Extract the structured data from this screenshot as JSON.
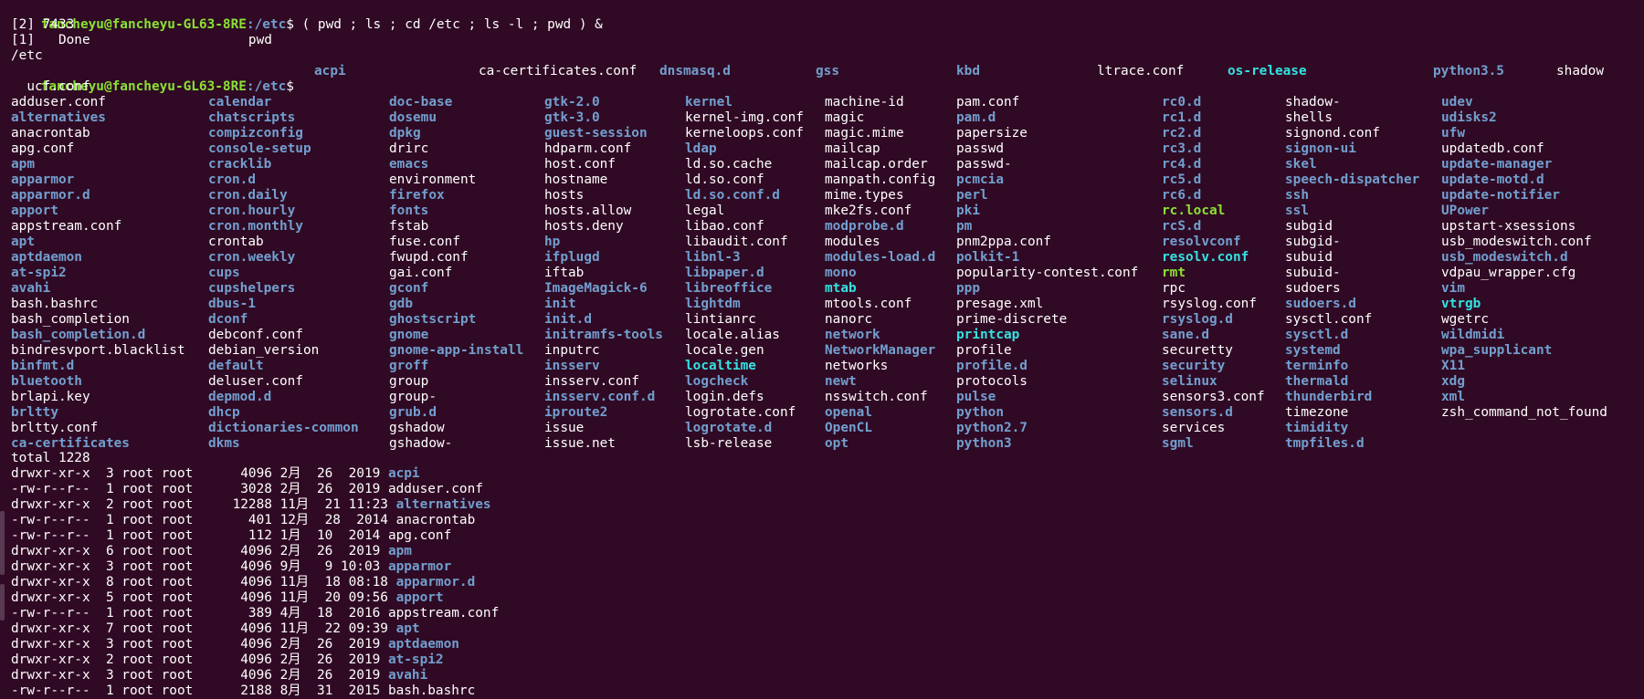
{
  "prompt": {
    "user_host": "fancheyu@fancheyu-GL63-8RE",
    "path": ":/etc",
    "symbol": "$ "
  },
  "command1": "( pwd ; ls ; cd /etc ; ls -l ; pwd ) &",
  "job_line": "[2] 7433",
  "done_line": "[1]   Done                    pwd",
  "pwd_output": "/etc",
  "command2_head": [
    "acpi",
    "ca-certificates.conf",
    "dnsmasq.d",
    "gss",
    "kbd",
    "ltrace.conf",
    "os-release",
    "python3.5",
    "shadow"
  ],
  "command2_head_types": [
    "dir",
    "plain",
    "dir",
    "dir",
    "dir",
    "plain",
    "lnk",
    "dir",
    "plain"
  ],
  "wrap_line": "  ucf.conf",
  "ls_columns": [
    [
      [
        "adduser.conf",
        "plain"
      ],
      [
        "alternatives",
        "dir"
      ],
      [
        "anacrontab",
        "plain"
      ],
      [
        "apg.conf",
        "plain"
      ],
      [
        "apm",
        "dir"
      ],
      [
        "apparmor",
        "dir"
      ],
      [
        "apparmor.d",
        "dir"
      ],
      [
        "apport",
        "dir"
      ],
      [
        "appstream.conf",
        "plain"
      ],
      [
        "apt",
        "dir"
      ],
      [
        "aptdaemon",
        "dir"
      ],
      [
        "at-spi2",
        "dir"
      ],
      [
        "avahi",
        "dir"
      ],
      [
        "bash.bashrc",
        "plain"
      ],
      [
        "bash_completion",
        "plain"
      ],
      [
        "bash_completion.d",
        "dir"
      ],
      [
        "bindresvport.blacklist",
        "plain"
      ],
      [
        "binfmt.d",
        "dir"
      ],
      [
        "bluetooth",
        "dir"
      ],
      [
        "brlapi.key",
        "plain"
      ],
      [
        "brltty",
        "dir"
      ],
      [
        "brltty.conf",
        "plain"
      ],
      [
        "ca-certificates",
        "dir"
      ]
    ],
    [
      [
        "calendar",
        "dir"
      ],
      [
        "chatscripts",
        "dir"
      ],
      [
        "compizconfig",
        "dir"
      ],
      [
        "console-setup",
        "dir"
      ],
      [
        "cracklib",
        "dir"
      ],
      [
        "cron.d",
        "dir"
      ],
      [
        "cron.daily",
        "dir"
      ],
      [
        "cron.hourly",
        "dir"
      ],
      [
        "cron.monthly",
        "dir"
      ],
      [
        "crontab",
        "plain"
      ],
      [
        "cron.weekly",
        "dir"
      ],
      [
        "cups",
        "dir"
      ],
      [
        "cupshelpers",
        "dir"
      ],
      [
        "dbus-1",
        "dir"
      ],
      [
        "dconf",
        "dir"
      ],
      [
        "debconf.conf",
        "plain"
      ],
      [
        "debian_version",
        "plain"
      ],
      [
        "default",
        "dir"
      ],
      [
        "deluser.conf",
        "plain"
      ],
      [
        "depmod.d",
        "dir"
      ],
      [
        "dhcp",
        "dir"
      ],
      [
        "dictionaries-common",
        "dir"
      ],
      [
        "dkms",
        "dir"
      ]
    ],
    [
      [
        "doc-base",
        "dir"
      ],
      [
        "dosemu",
        "dir"
      ],
      [
        "dpkg",
        "dir"
      ],
      [
        "drirc",
        "plain"
      ],
      [
        "emacs",
        "dir"
      ],
      [
        "environment",
        "plain"
      ],
      [
        "firefox",
        "dir"
      ],
      [
        "fonts",
        "dir"
      ],
      [
        "fstab",
        "plain"
      ],
      [
        "fuse.conf",
        "plain"
      ],
      [
        "fwupd.conf",
        "plain"
      ],
      [
        "gai.conf",
        "plain"
      ],
      [
        "gconf",
        "dir"
      ],
      [
        "gdb",
        "dir"
      ],
      [
        "ghostscript",
        "dir"
      ],
      [
        "gnome",
        "dir"
      ],
      [
        "gnome-app-install",
        "dir"
      ],
      [
        "groff",
        "dir"
      ],
      [
        "group",
        "plain"
      ],
      [
        "group-",
        "plain"
      ],
      [
        "grub.d",
        "dir"
      ],
      [
        "gshadow",
        "plain"
      ],
      [
        "gshadow-",
        "plain"
      ]
    ],
    [
      [
        "gtk-2.0",
        "dir"
      ],
      [
        "gtk-3.0",
        "dir"
      ],
      [
        "guest-session",
        "dir"
      ],
      [
        "hdparm.conf",
        "plain"
      ],
      [
        "host.conf",
        "plain"
      ],
      [
        "hostname",
        "plain"
      ],
      [
        "hosts",
        "plain"
      ],
      [
        "hosts.allow",
        "plain"
      ],
      [
        "hosts.deny",
        "plain"
      ],
      [
        "hp",
        "dir"
      ],
      [
        "ifplugd",
        "dir"
      ],
      [
        "iftab",
        "plain"
      ],
      [
        "ImageMagick-6",
        "dir"
      ],
      [
        "init",
        "dir"
      ],
      [
        "init.d",
        "dir"
      ],
      [
        "initramfs-tools",
        "dir"
      ],
      [
        "inputrc",
        "plain"
      ],
      [
        "insserv",
        "dir"
      ],
      [
        "insserv.conf",
        "plain"
      ],
      [
        "insserv.conf.d",
        "dir"
      ],
      [
        "iproute2",
        "dir"
      ],
      [
        "issue",
        "plain"
      ],
      [
        "issue.net",
        "plain"
      ]
    ],
    [
      [
        "kernel",
        "dir"
      ],
      [
        "kernel-img.conf",
        "plain"
      ],
      [
        "kerneloops.conf",
        "plain"
      ],
      [
        "ldap",
        "dir"
      ],
      [
        "ld.so.cache",
        "plain"
      ],
      [
        "ld.so.conf",
        "plain"
      ],
      [
        "ld.so.conf.d",
        "dir"
      ],
      [
        "legal",
        "plain"
      ],
      [
        "libao.conf",
        "plain"
      ],
      [
        "libaudit.conf",
        "plain"
      ],
      [
        "libnl-3",
        "dir"
      ],
      [
        "libpaper.d",
        "dir"
      ],
      [
        "libreoffice",
        "dir"
      ],
      [
        "lightdm",
        "dir"
      ],
      [
        "lintianrc",
        "plain"
      ],
      [
        "locale.alias",
        "plain"
      ],
      [
        "locale.gen",
        "plain"
      ],
      [
        "localtime",
        "lnk"
      ],
      [
        "logcheck",
        "dir"
      ],
      [
        "login.defs",
        "plain"
      ],
      [
        "logrotate.conf",
        "plain"
      ],
      [
        "logrotate.d",
        "dir"
      ],
      [
        "lsb-release",
        "plain"
      ]
    ],
    [
      [
        "machine-id",
        "plain"
      ],
      [
        "magic",
        "plain"
      ],
      [
        "magic.mime",
        "plain"
      ],
      [
        "mailcap",
        "plain"
      ],
      [
        "mailcap.order",
        "plain"
      ],
      [
        "manpath.config",
        "plain"
      ],
      [
        "mime.types",
        "plain"
      ],
      [
        "mke2fs.conf",
        "plain"
      ],
      [
        "modprobe.d",
        "dir"
      ],
      [
        "modules",
        "plain"
      ],
      [
        "modules-load.d",
        "dir"
      ],
      [
        "mono",
        "dir"
      ],
      [
        "mtab",
        "lnk"
      ],
      [
        "mtools.conf",
        "plain"
      ],
      [
        "nanorc",
        "plain"
      ],
      [
        "network",
        "dir"
      ],
      [
        "NetworkManager",
        "dir"
      ],
      [
        "networks",
        "plain"
      ],
      [
        "newt",
        "dir"
      ],
      [
        "nsswitch.conf",
        "plain"
      ],
      [
        "openal",
        "dir"
      ],
      [
        "OpenCL",
        "dir"
      ],
      [
        "opt",
        "dir"
      ]
    ],
    [
      [
        "pam.conf",
        "plain"
      ],
      [
        "pam.d",
        "dir"
      ],
      [
        "papersize",
        "plain"
      ],
      [
        "passwd",
        "plain"
      ],
      [
        "passwd-",
        "plain"
      ],
      [
        "pcmcia",
        "dir"
      ],
      [
        "perl",
        "dir"
      ],
      [
        "pki",
        "dir"
      ],
      [
        "pm",
        "dir"
      ],
      [
        "pnm2ppa.conf",
        "plain"
      ],
      [
        "polkit-1",
        "dir"
      ],
      [
        "popularity-contest.conf",
        "plain"
      ],
      [
        "ppp",
        "dir"
      ],
      [
        "presage.xml",
        "plain"
      ],
      [
        "prime-discrete",
        "plain"
      ],
      [
        "printcap",
        "lnk"
      ],
      [
        "profile",
        "plain"
      ],
      [
        "profile.d",
        "dir"
      ],
      [
        "protocols",
        "plain"
      ],
      [
        "pulse",
        "dir"
      ],
      [
        "python",
        "dir"
      ],
      [
        "python2.7",
        "dir"
      ],
      [
        "python3",
        "dir"
      ]
    ],
    [
      [
        "rc0.d",
        "dir"
      ],
      [
        "rc1.d",
        "dir"
      ],
      [
        "rc2.d",
        "dir"
      ],
      [
        "rc3.d",
        "dir"
      ],
      [
        "rc4.d",
        "dir"
      ],
      [
        "rc5.d",
        "dir"
      ],
      [
        "rc6.d",
        "dir"
      ],
      [
        "rc.local",
        "exe"
      ],
      [
        "rcS.d",
        "dir"
      ],
      [
        "resolvconf",
        "dir"
      ],
      [
        "resolv.conf",
        "lnk"
      ],
      [
        "rmt",
        "exe"
      ],
      [
        "rpc",
        "plain"
      ],
      [
        "rsyslog.conf",
        "plain"
      ],
      [
        "rsyslog.d",
        "dir"
      ],
      [
        "sane.d",
        "dir"
      ],
      [
        "securetty",
        "plain"
      ],
      [
        "security",
        "dir"
      ],
      [
        "selinux",
        "dir"
      ],
      [
        "sensors3.conf",
        "plain"
      ],
      [
        "sensors.d",
        "dir"
      ],
      [
        "services",
        "plain"
      ],
      [
        "sgml",
        "dir"
      ]
    ],
    [
      [
        "shadow-",
        "plain"
      ],
      [
        "shells",
        "plain"
      ],
      [
        "signond.conf",
        "plain"
      ],
      [
        "signon-ui",
        "dir"
      ],
      [
        "skel",
        "dir"
      ],
      [
        "speech-dispatcher",
        "dir"
      ],
      [
        "ssh",
        "dir"
      ],
      [
        "ssl",
        "dir"
      ],
      [
        "subgid",
        "plain"
      ],
      [
        "subgid-",
        "plain"
      ],
      [
        "subuid",
        "plain"
      ],
      [
        "subuid-",
        "plain"
      ],
      [
        "sudoers",
        "plain"
      ],
      [
        "sudoers.d",
        "dir"
      ],
      [
        "sysctl.conf",
        "plain"
      ],
      [
        "sysctl.d",
        "dir"
      ],
      [
        "systemd",
        "dir"
      ],
      [
        "terminfo",
        "dir"
      ],
      [
        "thermald",
        "dir"
      ],
      [
        "thunderbird",
        "dir"
      ],
      [
        "timezone",
        "plain"
      ],
      [
        "timidity",
        "dir"
      ],
      [
        "tmpfiles.d",
        "dir"
      ]
    ],
    [
      [
        "udev",
        "dir"
      ],
      [
        "udisks2",
        "dir"
      ],
      [
        "ufw",
        "dir"
      ],
      [
        "updatedb.conf",
        "plain"
      ],
      [
        "update-manager",
        "dir"
      ],
      [
        "update-motd.d",
        "dir"
      ],
      [
        "update-notifier",
        "dir"
      ],
      [
        "UPower",
        "dir"
      ],
      [
        "upstart-xsessions",
        "plain"
      ],
      [
        "usb_modeswitch.conf",
        "plain"
      ],
      [
        "usb_modeswitch.d",
        "dir"
      ],
      [
        "vdpau_wrapper.cfg",
        "plain"
      ],
      [
        "vim",
        "dir"
      ],
      [
        "vtrgb",
        "lnk"
      ],
      [
        "wgetrc",
        "plain"
      ],
      [
        "wildmidi",
        "dir"
      ],
      [
        "wpa_supplicant",
        "dir"
      ],
      [
        "X11",
        "dir"
      ],
      [
        "xdg",
        "dir"
      ],
      [
        "xml",
        "dir"
      ],
      [
        "zsh_command_not_found",
        "plain"
      ]
    ]
  ],
  "total_line": "total 1228",
  "long_listing": [
    {
      "perm": "drwxr-xr-x",
      "links": "3",
      "owner": "root",
      "group": "root",
      "size": "4096",
      "month": "2月",
      "day": "26",
      "time": "2019",
      "name": "acpi",
      "type": "dir"
    },
    {
      "perm": "-rw-r--r--",
      "links": "1",
      "owner": "root",
      "group": "root",
      "size": "3028",
      "month": "2月",
      "day": "26",
      "time": "2019",
      "name": "adduser.conf",
      "type": "plain"
    },
    {
      "perm": "drwxr-xr-x",
      "links": "2",
      "owner": "root",
      "group": "root",
      "size": "12288",
      "month": "11月",
      "day": "21",
      "time": "11:23",
      "name": "alternatives",
      "type": "dir"
    },
    {
      "perm": "-rw-r--r--",
      "links": "1",
      "owner": "root",
      "group": "root",
      "size": "401",
      "month": "12月",
      "day": "28",
      "time": "2014",
      "name": "anacrontab",
      "type": "plain"
    },
    {
      "perm": "-rw-r--r--",
      "links": "1",
      "owner": "root",
      "group": "root",
      "size": "112",
      "month": "1月",
      "day": "10",
      "time": "2014",
      "name": "apg.conf",
      "type": "plain"
    },
    {
      "perm": "drwxr-xr-x",
      "links": "6",
      "owner": "root",
      "group": "root",
      "size": "4096",
      "month": "2月",
      "day": "26",
      "time": "2019",
      "name": "apm",
      "type": "dir"
    },
    {
      "perm": "drwxr-xr-x",
      "links": "3",
      "owner": "root",
      "group": "root",
      "size": "4096",
      "month": "9月",
      "day": "9",
      "time": "10:03",
      "name": "apparmor",
      "type": "dir"
    },
    {
      "perm": "drwxr-xr-x",
      "links": "8",
      "owner": "root",
      "group": "root",
      "size": "4096",
      "month": "11月",
      "day": "18",
      "time": "08:18",
      "name": "apparmor.d",
      "type": "dir"
    },
    {
      "perm": "drwxr-xr-x",
      "links": "5",
      "owner": "root",
      "group": "root",
      "size": "4096",
      "month": "11月",
      "day": "20",
      "time": "09:56",
      "name": "apport",
      "type": "dir"
    },
    {
      "perm": "-rw-r--r--",
      "links": "1",
      "owner": "root",
      "group": "root",
      "size": "389",
      "month": "4月",
      "day": "18",
      "time": "2016",
      "name": "appstream.conf",
      "type": "plain"
    },
    {
      "perm": "drwxr-xr-x",
      "links": "7",
      "owner": "root",
      "group": "root",
      "size": "4096",
      "month": "11月",
      "day": "22",
      "time": "09:39",
      "name": "apt",
      "type": "dir"
    },
    {
      "perm": "drwxr-xr-x",
      "links": "3",
      "owner": "root",
      "group": "root",
      "size": "4096",
      "month": "2月",
      "day": "26",
      "time": "2019",
      "name": "aptdaemon",
      "type": "dir"
    },
    {
      "perm": "drwxr-xr-x",
      "links": "2",
      "owner": "root",
      "group": "root",
      "size": "4096",
      "month": "2月",
      "day": "26",
      "time": "2019",
      "name": "at-spi2",
      "type": "dir"
    },
    {
      "perm": "drwxr-xr-x",
      "links": "3",
      "owner": "root",
      "group": "root",
      "size": "4096",
      "month": "2月",
      "day": "26",
      "time": "2019",
      "name": "avahi",
      "type": "dir"
    },
    {
      "perm": "-rw-r--r--",
      "links": "1",
      "owner": "root",
      "group": "root",
      "size": "2188",
      "month": "8月",
      "day": "31",
      "time": "2015",
      "name": "bash.bashrc",
      "type": "plain"
    }
  ],
  "colors": {
    "background": "#300a24",
    "user": "#8ae234",
    "directory": "#729fcf",
    "symlink": "#34e2e2",
    "text": "#ffffff"
  }
}
